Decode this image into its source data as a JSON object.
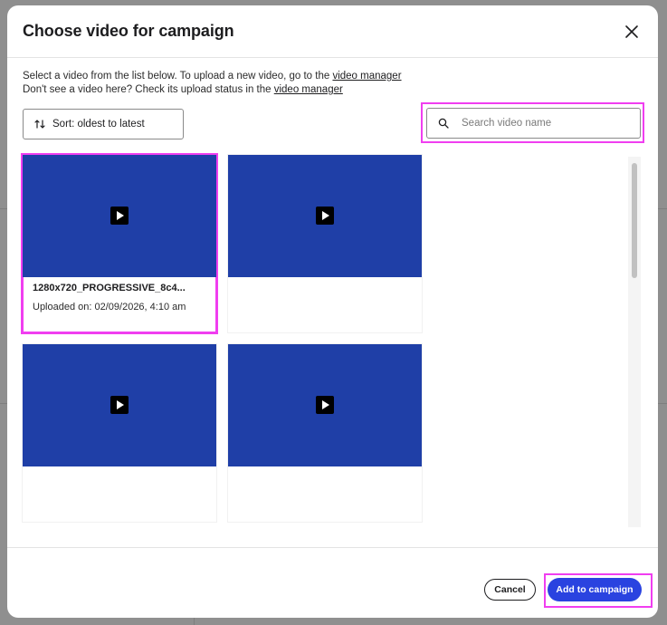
{
  "modal": {
    "title": "Choose video for campaign",
    "description_line1_prefix": "Select a video from the list below. To upload a new video, go to the ",
    "description_line1_link": "video manager",
    "description_line2_prefix": "Don't see a video here? Check its upload status in the ",
    "description_line2_link": "video manager"
  },
  "toolbar": {
    "sort_label": "Sort: oldest to latest",
    "search_placeholder": "Search video name"
  },
  "videos": [
    {
      "title": "1280x720_PROGRESSIVE_8c4...",
      "uploaded": "Uploaded on: 02/09/2026, 4:10 am",
      "selected": true
    },
    {
      "title": "",
      "uploaded": "",
      "selected": false
    },
    {
      "title": "",
      "uploaded": "",
      "selected": false
    },
    {
      "title": "",
      "uploaded": "",
      "selected": false
    }
  ],
  "footer": {
    "cancel_label": "Cancel",
    "add_label": "Add to campaign"
  },
  "colors": {
    "thumbnail": "#1f3fa7",
    "primary_button": "#2a43e0",
    "highlight": "#f03ef0"
  },
  "icons": [
    "close-icon",
    "sort-icon",
    "search-icon",
    "play-icon"
  ]
}
